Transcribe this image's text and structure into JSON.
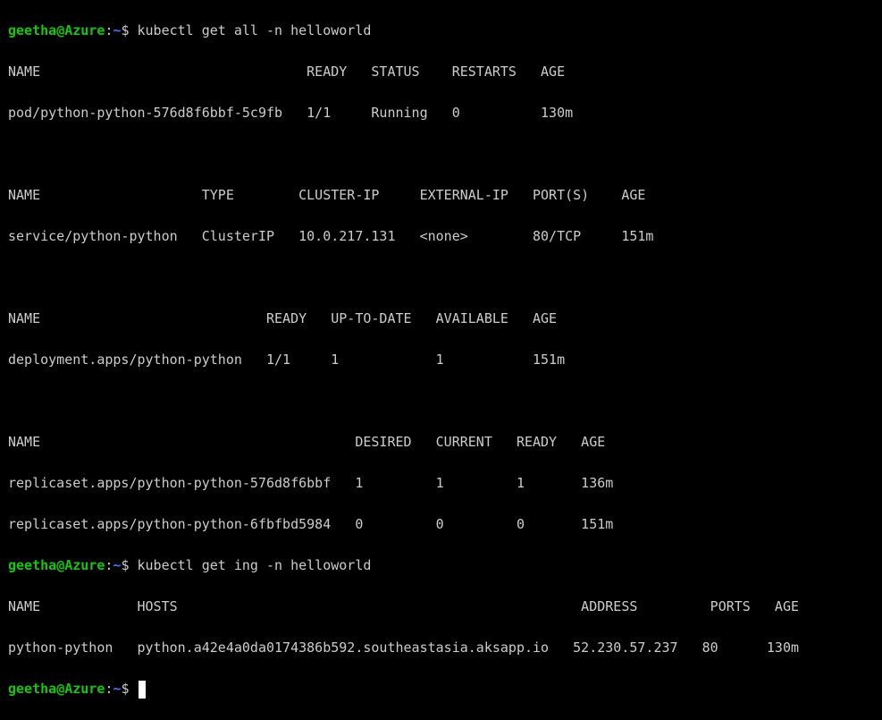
{
  "prompt": {
    "user": "geetha",
    "at": "@",
    "host": "Azure",
    "colon": ":",
    "path": "~",
    "dollar": "$ "
  },
  "commands": [
    "kubectl get all -n helloworld",
    "kubectl get ing -n helloworld"
  ],
  "output": {
    "pods": {
      "header": "NAME                                 READY   STATUS    RESTARTS   AGE",
      "rows": [
        "pod/python-python-576d8f6bbf-5c9fb   1/1     Running   0          130m"
      ]
    },
    "services": {
      "header": "NAME                    TYPE        CLUSTER-IP     EXTERNAL-IP   PORT(S)    AGE",
      "rows": [
        "service/python-python   ClusterIP   10.0.217.131   <none>        80/TCP     151m"
      ]
    },
    "deployments": {
      "header": "NAME                            READY   UP-TO-DATE   AVAILABLE   AGE",
      "rows": [
        "deployment.apps/python-python   1/1     1            1           151m"
      ]
    },
    "replicasets": {
      "header": "NAME                                       DESIRED   CURRENT   READY   AGE",
      "rows": [
        "replicaset.apps/python-python-576d8f6bbf   1         1         1       136m",
        "replicaset.apps/python-python-6fbfbd5984   0         0         0       151m"
      ]
    },
    "ingress": {
      "header": "NAME            HOSTS                                                  ADDRESS         PORTS   AGE",
      "rows": [
        "python-python   python.a42e4a0da0174386b592.southeastasia.aksapp.io   52.230.57.237   80      130m"
      ]
    }
  }
}
